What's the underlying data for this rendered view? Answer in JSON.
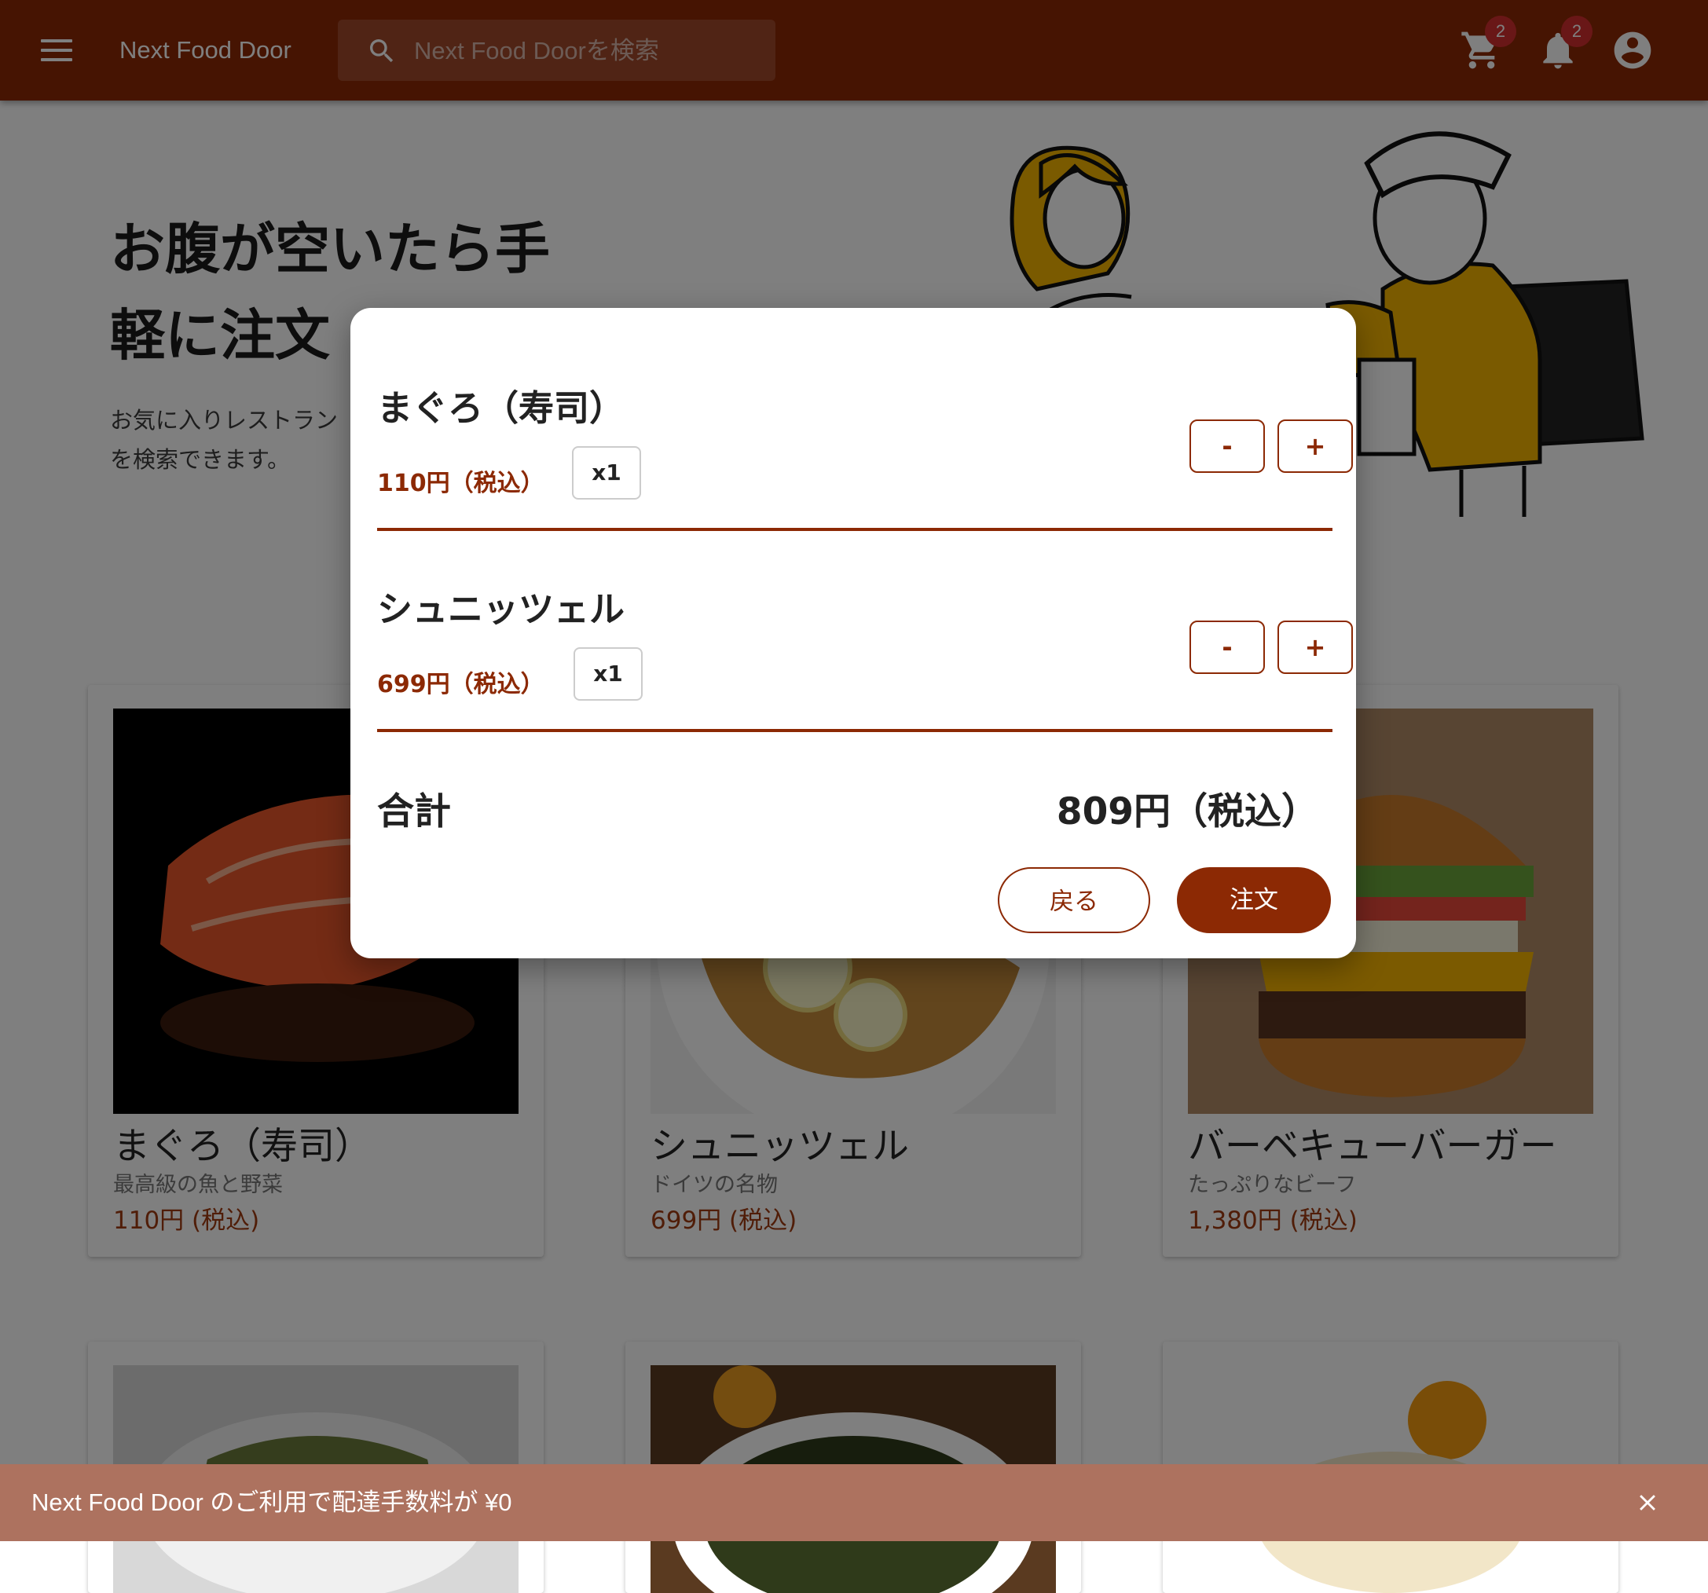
{
  "app": {
    "brand": "Next Food Door",
    "search_placeholder": "Next Food Doorを検索",
    "cart_count": "2",
    "notification_count": "2"
  },
  "hero": {
    "title_line1": "お腹が空いたら手",
    "title_line2": "軽に注文",
    "subtitle_line1": "お気に入りレストラン",
    "subtitle_line2": "を検索できます。"
  },
  "menu_items": [
    {
      "name": "まぐろ（寿司）",
      "desc": "最高級の魚と野菜",
      "price": "110円 (税込)"
    },
    {
      "name": "シュニッツェル",
      "desc": "ドイツの名物",
      "price": "699円 (税込)"
    },
    {
      "name": "バーベキューバーガー",
      "desc": "たっぷりなビーフ",
      "price": "1,380円 (税込)"
    }
  ],
  "cart_dialog": {
    "items": [
      {
        "name": "まぐろ（寿司）",
        "price": "110円（税込）",
        "qty": "x1",
        "minus": "-",
        "plus": "+"
      },
      {
        "name": "シュニッツェル",
        "price": "699円（税込）",
        "qty": "x1",
        "minus": "-",
        "plus": "+"
      }
    ],
    "total_label": "合計",
    "total_value": "809円（税込）",
    "back_label": "戻る",
    "order_label": "注文"
  },
  "snackbar": {
    "message": "Next Food Door のご利用で配達手数料が ¥0"
  },
  "colors": {
    "primary": "#8c2904",
    "badge": "#d32f2f",
    "snackbar": "#ad725f"
  },
  "icons": [
    "menu-icon",
    "search-icon",
    "cart-icon",
    "bell-icon",
    "account-icon",
    "close-icon"
  ]
}
